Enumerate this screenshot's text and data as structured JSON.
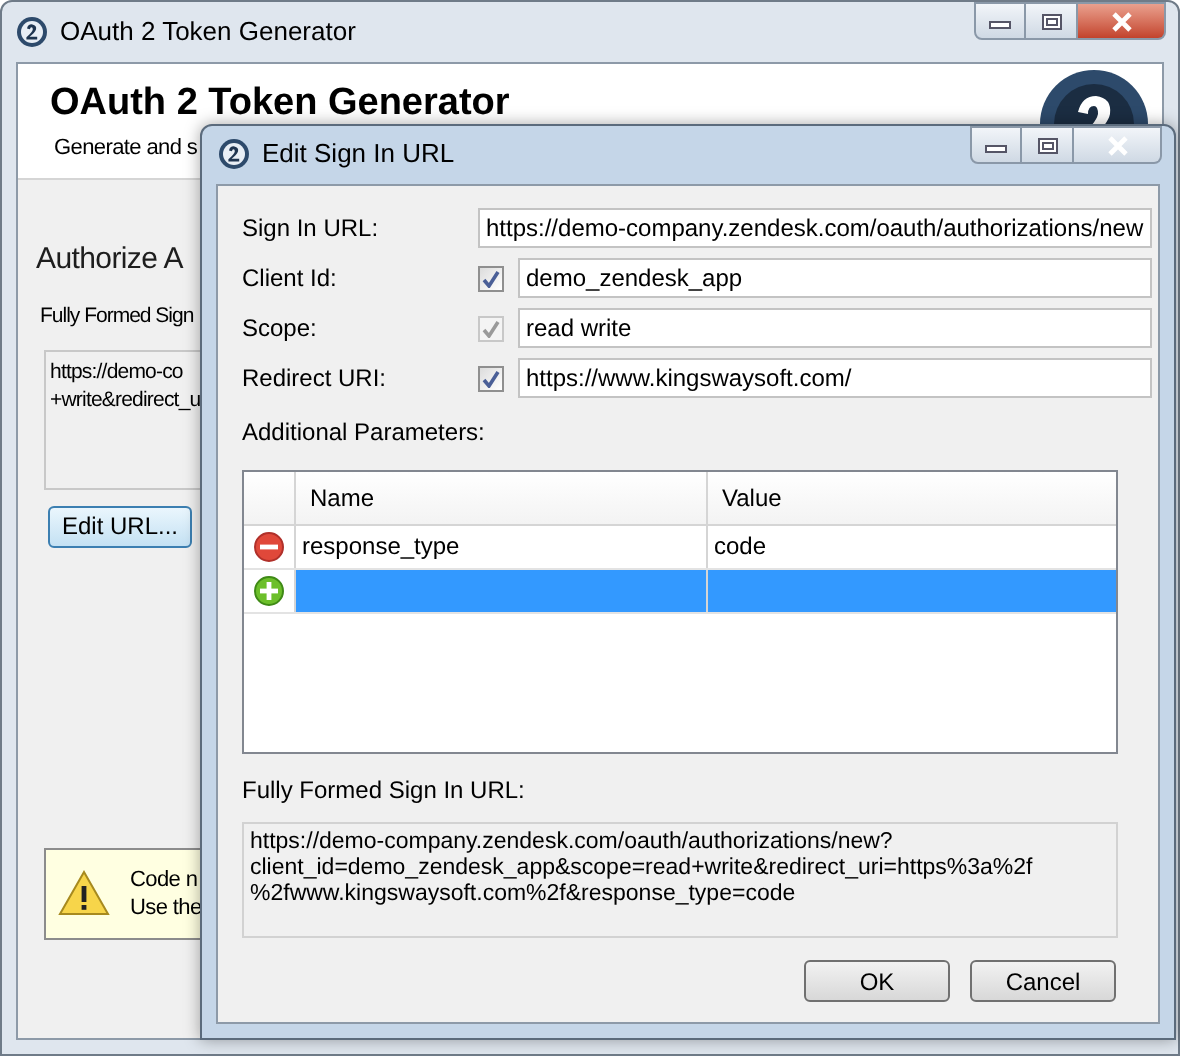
{
  "main_window": {
    "title": "OAuth 2 Token Generator",
    "header_title": "OAuth 2 Token Generator",
    "header_subtitle": "Generate and s",
    "section_title": "Authorize A",
    "url_label": "Fully Formed Sign",
    "url_lines": [
      "https://demo-co",
      "+write&redirect_u"
    ],
    "edit_button": "Edit URL...",
    "warning_lines": [
      "Code n",
      "Use the"
    ]
  },
  "dialog": {
    "title": "Edit Sign In URL",
    "sign_in_url": {
      "label": "Sign In URL:",
      "value": "https://demo-company.zendesk.com/oauth/authorizations/new"
    },
    "options": [
      {
        "label": "Client Id:",
        "checked": true,
        "disabled": false,
        "value": "demo_zendesk_app"
      },
      {
        "label": "Scope:",
        "checked": true,
        "disabled": true,
        "value": "read write"
      },
      {
        "label": "Redirect URI:",
        "checked": true,
        "disabled": false,
        "value": "https://www.kingswaysoft.com/"
      }
    ],
    "parameters_label": "Additional Parameters:",
    "table": {
      "columns": [
        "Name",
        "Value"
      ],
      "rows": [
        {
          "kind": "remove",
          "name": "response_type",
          "value": "code",
          "selected": false
        },
        {
          "kind": "add",
          "selected": true
        }
      ]
    },
    "url_label": "Fully Formed Sign In URL:",
    "url_lines": [
      "https://demo-company.zendesk.com/oauth/authorizations/new?",
      "client_id=demo_zendesk_app&scope=read+write&redirect_uri=https%3a%2f",
      "%2fwww.kingswaysoft.com%2f&response_type=code"
    ],
    "buttons": [
      "OK",
      "Cancel"
    ]
  }
}
